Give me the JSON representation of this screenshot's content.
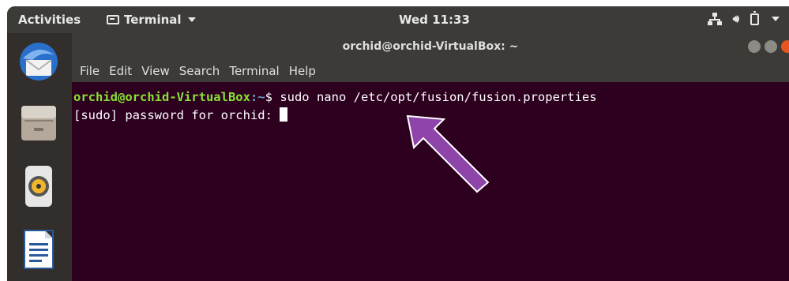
{
  "topbar": {
    "activities": "Activities",
    "app_menu": "Terminal",
    "clock": "Wed 11:33"
  },
  "window": {
    "title": "orchid@orchid-VirtualBox: ~",
    "menu": [
      "File",
      "Edit",
      "View",
      "Search",
      "Terminal",
      "Help"
    ]
  },
  "terminal": {
    "prompt_user": "orchid@orchid-VirtualBox",
    "prompt_path": ":~",
    "prompt_symbol": "$ ",
    "command": "sudo nano /etc/opt/fusion/fusion.properties",
    "line2": "[sudo] password for orchid: "
  },
  "dock": {
    "items": [
      "thunderbird-icon",
      "files-icon",
      "rhythmbox-icon",
      "writer-icon"
    ]
  },
  "colors": {
    "terminal_bg": "#2c001e",
    "topbar_bg": "#3c3b37",
    "prompt_user": "#8ae234",
    "prompt_path": "#729fcf",
    "arrow": "#8e44a8"
  }
}
